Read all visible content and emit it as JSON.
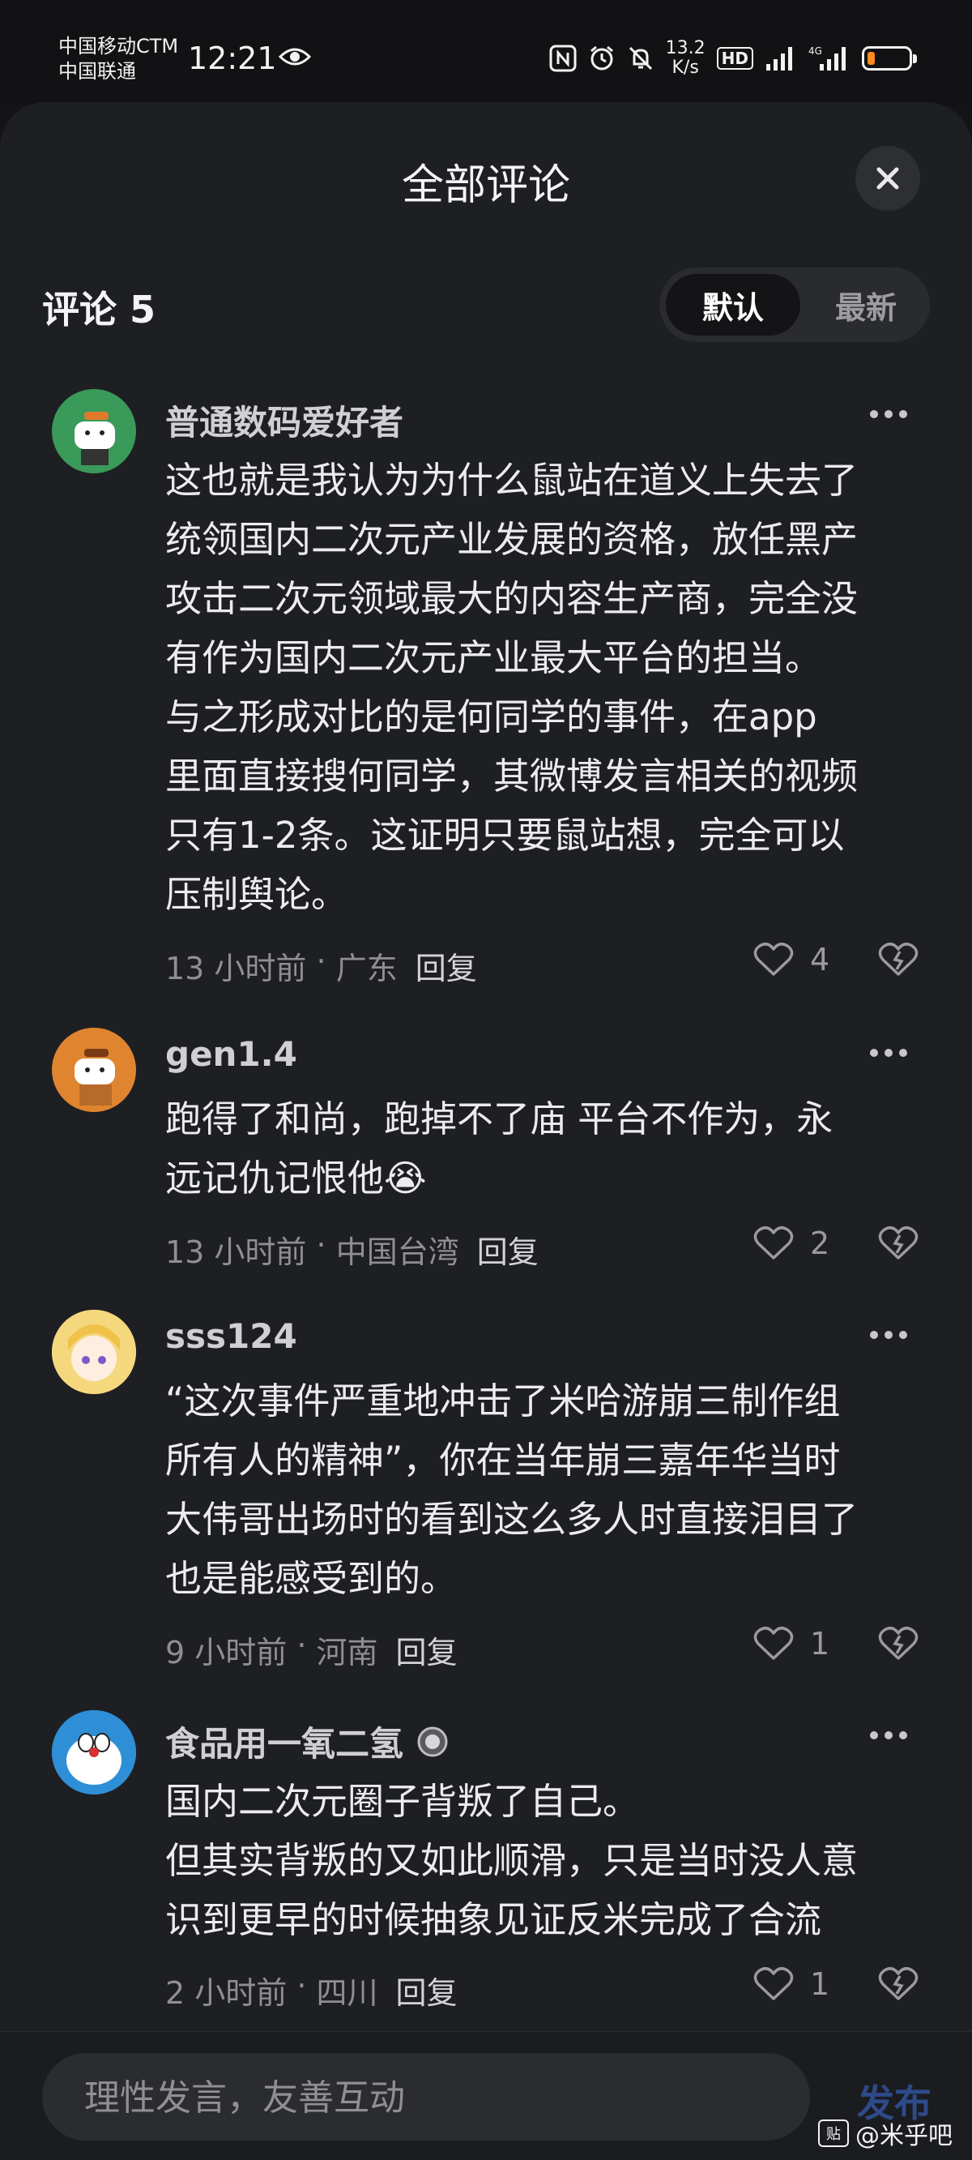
{
  "status_bar": {
    "carrier_1": "中国移动CTM",
    "carrier_2": "中国联通",
    "time": "12:21",
    "speed_value": "13.2",
    "speed_unit": "K/s",
    "hd_label": "HD",
    "battery_level": 0.18,
    "battery_color": "#ff8a1f",
    "icons": [
      "eye-icon",
      "nfc-icon",
      "alarm-icon",
      "mute-icon",
      "signal-icon",
      "signal-4g-icon",
      "battery-icon"
    ]
  },
  "sheet": {
    "title": "全部评论",
    "count_label": "评论 5",
    "sort": {
      "default_label": "默认",
      "newest_label": "最新",
      "selected": "默认"
    }
  },
  "comments": [
    {
      "username": "普通数码爱好者",
      "avatar_color": "#3a9a5a",
      "text": "这也就是我认为为什么鼠站在道义上失去了\n统领国内二次元产业发展的资格，放任黑产\n攻击二次元领域最大的内容生产商，完全没\n有作为国内二次元产业最大平台的担当。\n与之形成对比的是何同学的事件，在app\n里面直接搜何同学，其微博发言相关的视频\n只有1-2条。这证明只要鼠站想，完全可以\n压制舆论。",
      "time": "13 小时前",
      "location": "广东",
      "reply_label": "回复",
      "likes": "4"
    },
    {
      "username": "gen1.4",
      "avatar_color": "#e0852f",
      "text": "跑得了和尚，跑掉不了庙 平台不作为，永\n远记仇记恨他😭",
      "time": "13 小时前",
      "location": "中国台湾",
      "reply_label": "回复",
      "likes": "2"
    },
    {
      "username": "sss124",
      "avatar_color": "#f2d27a",
      "text": "“这次事件严重地冲击了米哈游崩三制作组\n所有人的精神”，你在当年崩三嘉年华当时\n大伟哥出场时的看到这么多人时直接泪目了\n也是能感受到的。",
      "time": "9 小时前",
      "location": "河南",
      "reply_label": "回复",
      "likes": "1"
    },
    {
      "username": "食品用一氧二氢",
      "avatar_color": "#2f8fd6",
      "has_badge": true,
      "text": "国内二次元圈子背叛了自己。\n但其实背叛的又如此顺滑，只是当时没人意\n识到更早的时候抽象见证反米完成了合流",
      "time": "2 小时前",
      "location": "四川",
      "reply_label": "回复",
      "likes": "1"
    }
  ],
  "bottom_bar": {
    "input_placeholder": "理性发言，友善互动",
    "publish_label": "发布"
  },
  "watermark": {
    "icon_label": "贴",
    "text": "@米乎吧"
  }
}
